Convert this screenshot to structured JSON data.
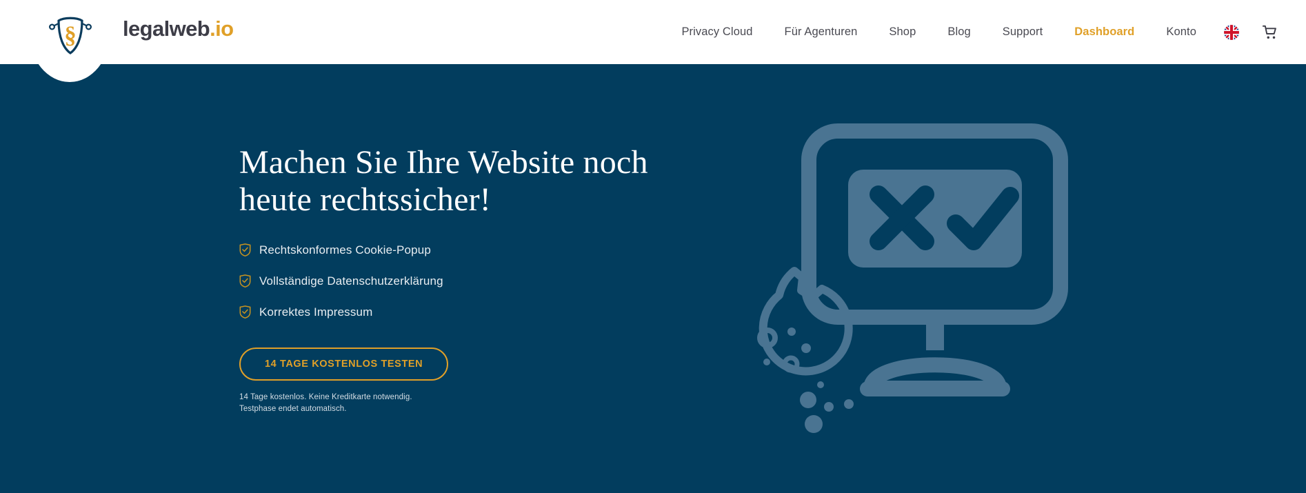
{
  "brand": {
    "name_main": "legalweb",
    "name_suffix": ".io",
    "logo_icon": "shield-paragraph-logo"
  },
  "nav": {
    "items": [
      {
        "label": "Privacy Cloud",
        "active": false
      },
      {
        "label": "Für Agenturen",
        "active": false
      },
      {
        "label": "Shop",
        "active": false
      },
      {
        "label": "Blog",
        "active": false
      },
      {
        "label": "Support",
        "active": false
      },
      {
        "label": "Dashboard",
        "active": true
      },
      {
        "label": "Konto",
        "active": false
      }
    ],
    "language_icon": "uk-flag-icon",
    "cart_icon": "shopping-cart-icon"
  },
  "hero": {
    "headline_line1": "Machen Sie Ihre Website noch",
    "headline_line2": "heute rechtssicher!",
    "bullets": [
      {
        "label": "Rechtskonformes Cookie-Popup",
        "icon": "shield-check-icon"
      },
      {
        "label": "Vollständige Datenschutzerklärung",
        "icon": "shield-check-icon"
      },
      {
        "label": "Korrektes Impressum",
        "icon": "shield-check-icon"
      }
    ],
    "cta_label": "14 TAGE KOSTENLOS TESTEN",
    "fineprint_line1": "14 Tage kostenlos. Keine Kreditkarte notwendig.",
    "fineprint_line2": "Testphase endet automatisch.",
    "illustration_icon": "monitor-cookie-consent-illustration"
  },
  "colors": {
    "background": "#023d5e",
    "accent_gold": "#e0a028",
    "header_bg": "#ffffff",
    "nav_text": "#4a4a52",
    "illustration_light": "#4a7492",
    "headline": "#ffffff"
  }
}
